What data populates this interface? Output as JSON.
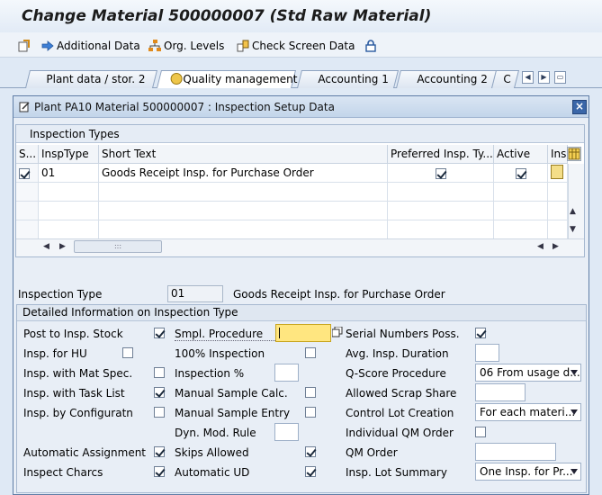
{
  "window_title": "Change Material 500000007 (Std Raw Material)",
  "toolbar": {
    "additional_data": "Additional Data",
    "org_levels": "Org. Levels",
    "check_screen_data": "Check Screen Data"
  },
  "tabs": [
    {
      "label": "Plant data / stor. 2"
    },
    {
      "label": "Quality management"
    },
    {
      "label": "Accounting 1"
    },
    {
      "label": "Accounting 2"
    },
    {
      "label": "C"
    }
  ],
  "dialog": {
    "title": "Plant PA10 Material 500000007 : Inspection Setup Data",
    "table": {
      "title": "Inspection Types",
      "columns": [
        "S...",
        "InspType",
        "Short Text",
        "Preferred Insp. Ty...",
        "Active",
        "Ins"
      ],
      "rows": [
        {
          "insp_type": "01",
          "short_text": "Goods Receipt Insp. for Purchase Order",
          "preferred": true,
          "active": true
        }
      ]
    },
    "inspection_type": {
      "label": "Inspection Type",
      "value": "01",
      "text": "Goods Receipt Insp. for Purchase Order"
    },
    "section_title": "Detailed Information on Inspection Type",
    "fields": {
      "post_to_insp_stock": "Post to Insp. Stock",
      "insp_for_hu": "Insp. for HU",
      "insp_with_mat_spec": "Insp. with Mat Spec.",
      "insp_with_task_list": "Insp. with Task List",
      "insp_by_configuratn": "Insp. by Configuratn",
      "automatic_assignment": "Automatic Assignment",
      "inspect_charcs": "Inspect Charcs",
      "smpl_procedure": "Smpl. Procedure",
      "hundred_pct_inspection": "100% Inspection",
      "inspection_pct": "Inspection %",
      "manual_sample_calc": "Manual Sample Calc.",
      "manual_sample_entry": "Manual Sample Entry",
      "dyn_mod_rule": "Dyn. Mod. Rule",
      "skips_allowed": "Skips Allowed",
      "automatic_ud": "Automatic UD",
      "serial_numbers_poss": "Serial Numbers Poss.",
      "avg_insp_duration": "Avg. Insp. Duration",
      "q_score_procedure": "Q-Score Procedure",
      "q_score_value": "06 From usage d...",
      "allowed_scrap_share": "Allowed Scrap Share",
      "control_lot_creation": "Control Lot Creation",
      "control_lot_value": "For each materi...",
      "individual_qm_order": "Individual QM Order",
      "qm_order": "QM Order",
      "insp_lot_summary": "Insp. Lot Summary",
      "insp_lot_summary_value": "One Insp. for Pr..."
    },
    "checks": {
      "post_to_insp_stock": true,
      "insp_for_hu": false,
      "insp_with_mat_spec": false,
      "insp_with_task_list": true,
      "insp_by_configuratn": false,
      "automatic_assignment": true,
      "inspect_charcs": true,
      "hundred_pct_inspection": false,
      "manual_sample_calc": false,
      "manual_sample_entry": false,
      "skips_allowed": true,
      "automatic_ud": true,
      "serial_numbers_poss": true,
      "individual_qm_order": false
    }
  },
  "colors": {
    "accent": "#3a66a8",
    "highlight_field": "#ffe680"
  }
}
